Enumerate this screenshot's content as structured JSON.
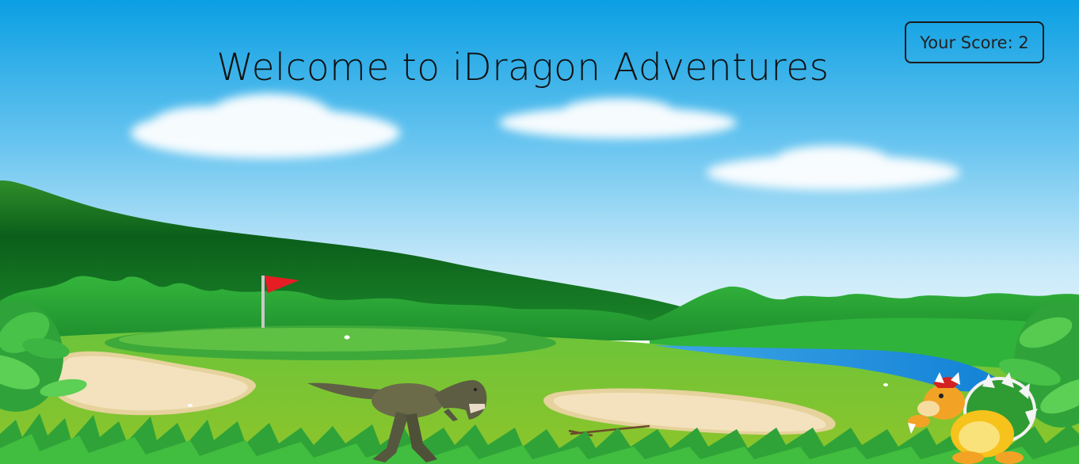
{
  "game": {
    "title": "Welcome to iDragon Adventures",
    "score_label": "Your Score:",
    "score_value": 2
  },
  "scene": {
    "setting": "golf course with hills, putting green, sand bunkers and a pond",
    "colors": {
      "sky_top": "#0a9fe3",
      "sky_bottom": "#d6effb",
      "hill_dark": "#0e6d21",
      "grass": "#8cc63f",
      "green": "#5fc144",
      "sand": "#f3e2bd",
      "water": "#1c92dd",
      "flag": "#e61d24"
    }
  },
  "sprites": {
    "player": "t-rex-dinosaur",
    "enemy": "bowser"
  }
}
